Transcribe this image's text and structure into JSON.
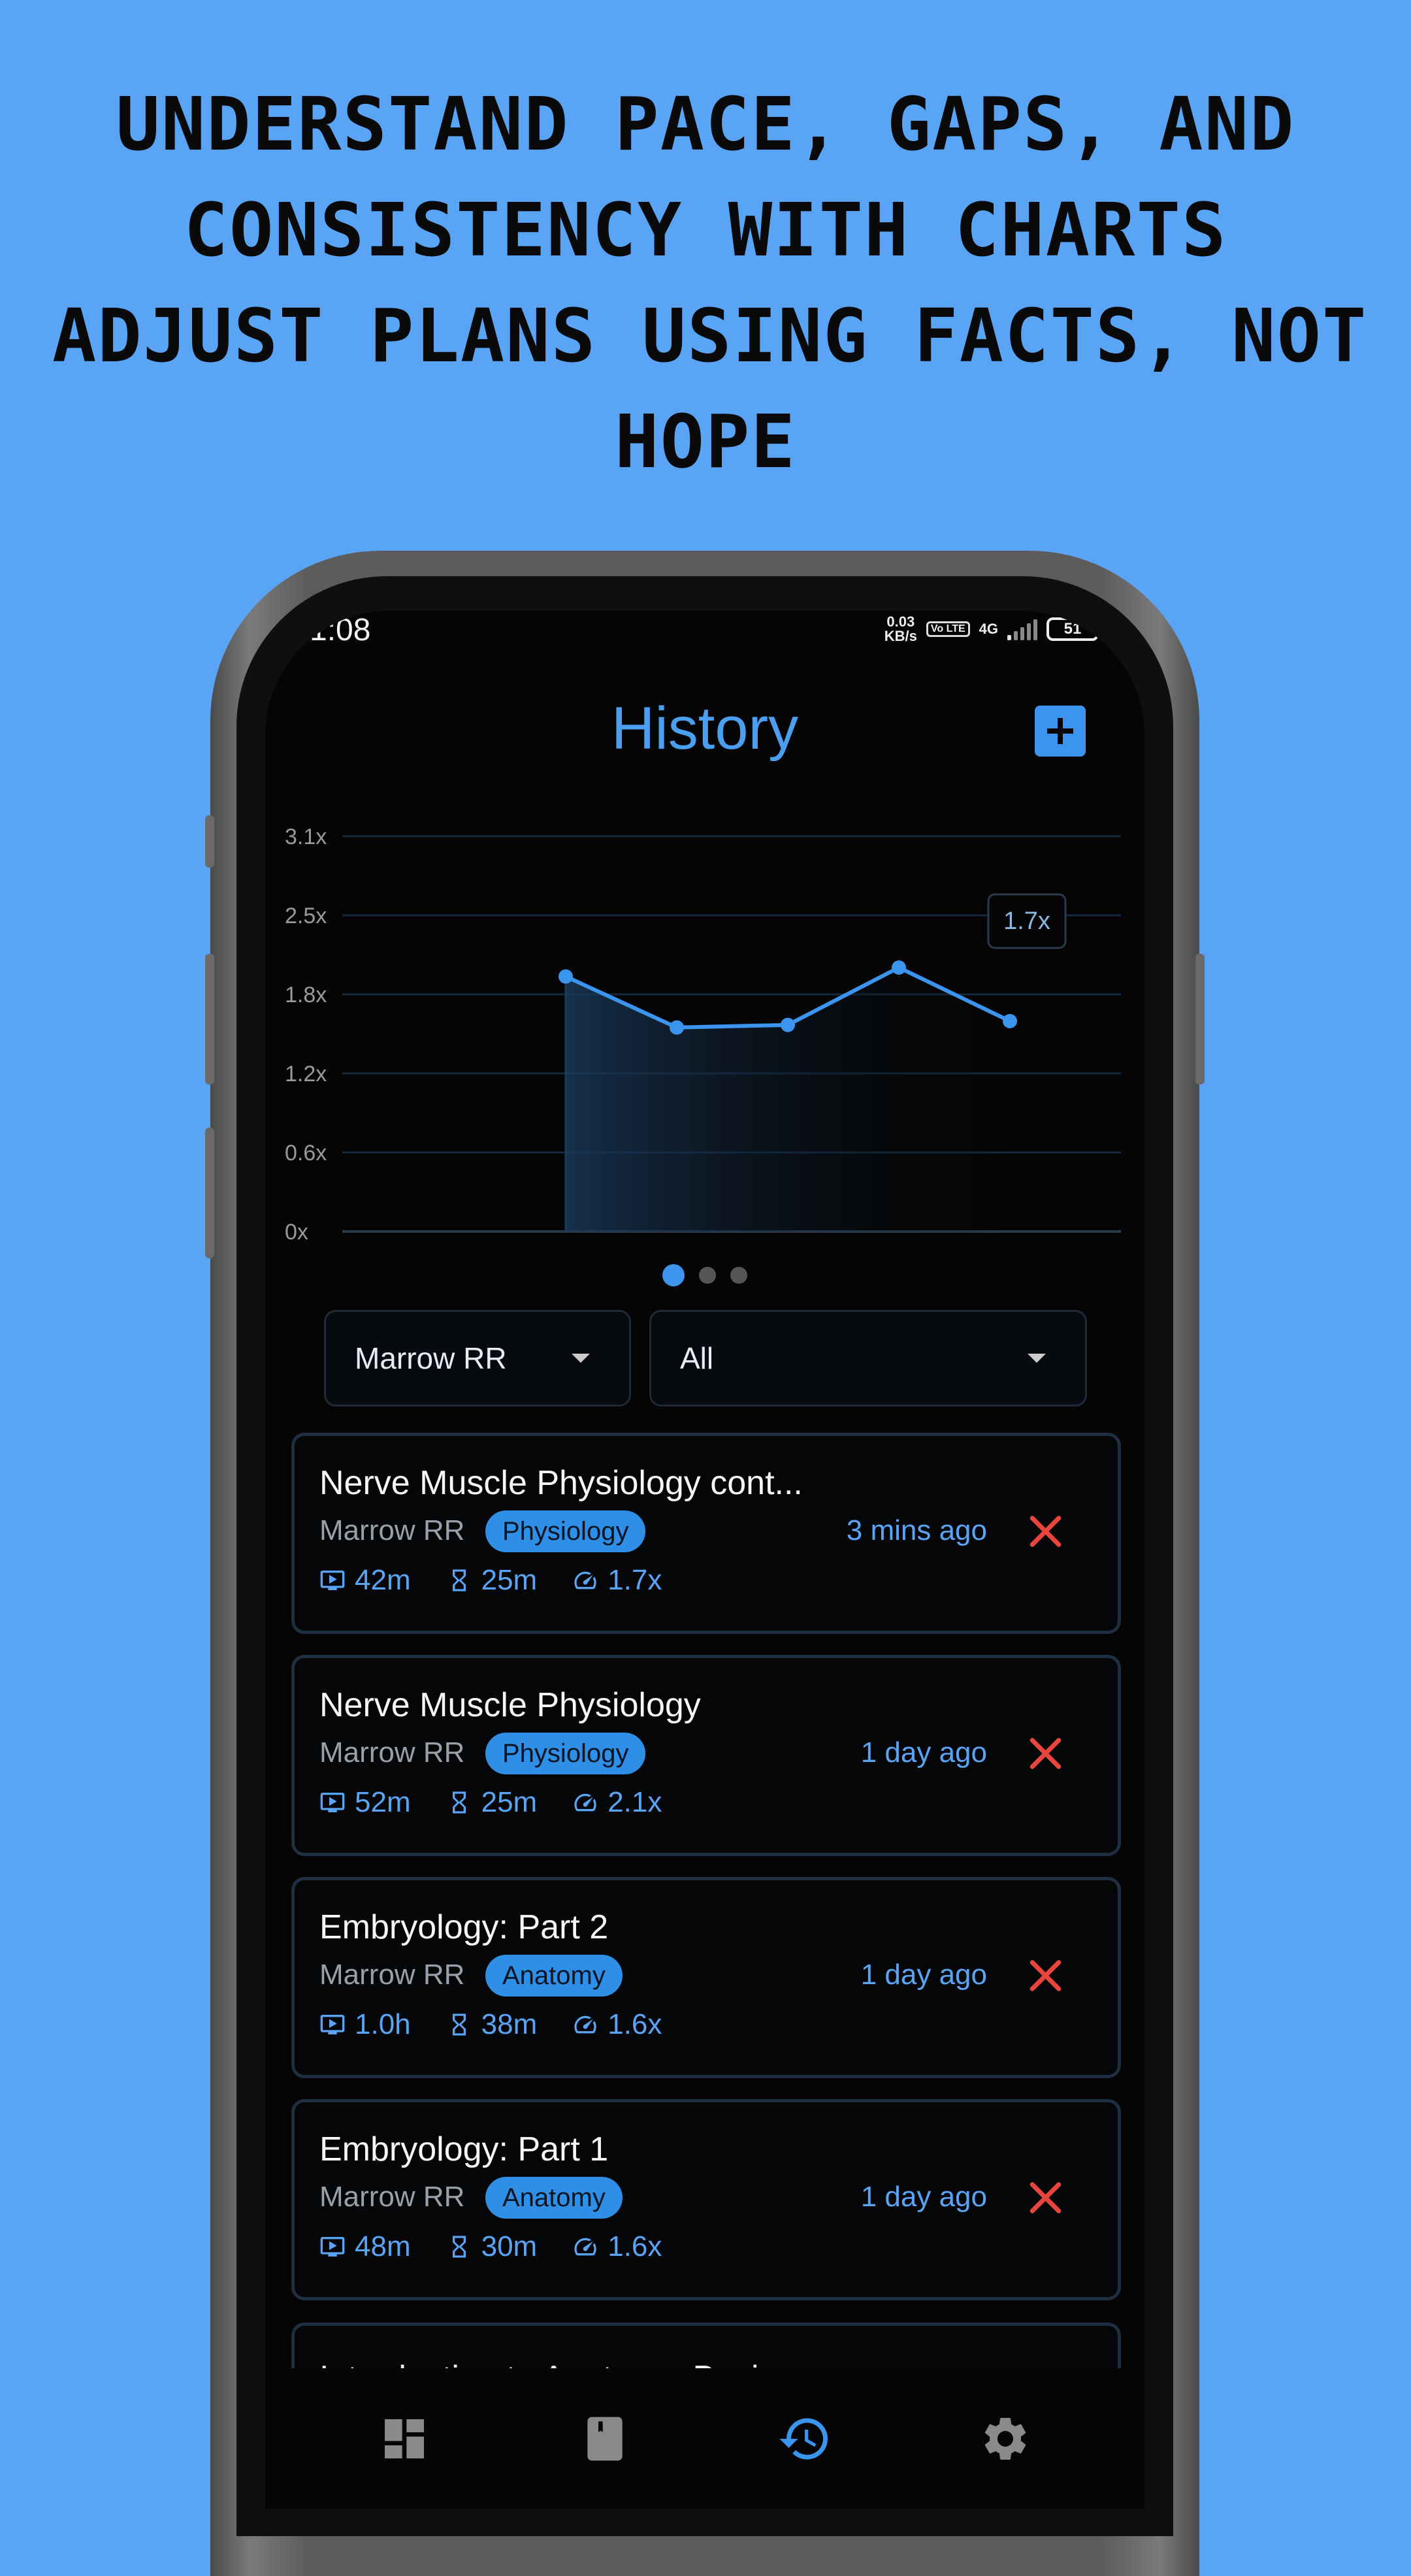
{
  "headline": {
    "line1": "UNDERSTAND PACE, GAPS, AND",
    "line2": "CONSISTENCY WITH CHARTS",
    "line3": "ADJUST PLANS USING FACTS, NOT",
    "line4": "HOPE"
  },
  "status_bar": {
    "time": "1:08",
    "speed_value": "0.03",
    "speed_unit": "KB/s",
    "volte": "Vo LTE",
    "network": "4G",
    "battery": "51"
  },
  "header": {
    "title": "History",
    "add_icon": "plus-icon"
  },
  "chart_data": {
    "type": "line",
    "y_tick_labels": [
      "3.1x",
      "2.5x",
      "1.8x",
      "1.2x",
      "0.6x",
      "0x"
    ],
    "ylim": [
      0,
      3.1
    ],
    "values": [
      2.0,
      1.6,
      1.62,
      2.07,
      1.65
    ],
    "tooltip": "1.7x",
    "line_color": "#3b95ee",
    "grid": true
  },
  "pager": {
    "count": 3,
    "active_index": 0
  },
  "filters": {
    "course": {
      "value": "Marrow RR"
    },
    "subject": {
      "value": "All"
    }
  },
  "sessions": [
    {
      "title": "Nerve Muscle Physiology cont...",
      "course": "Marrow RR",
      "subject": "Physiology",
      "time_ago": "3 mins ago",
      "video": "42m",
      "spent": "25m",
      "speed": "1.7x"
    },
    {
      "title": "Nerve Muscle Physiology",
      "course": "Marrow RR",
      "subject": "Physiology",
      "time_ago": "1 day ago",
      "video": "52m",
      "spent": "25m",
      "speed": "2.1x"
    },
    {
      "title": "Embryology: Part 2",
      "course": "Marrow RR",
      "subject": "Anatomy",
      "time_ago": "1 day ago",
      "video": "1.0h",
      "spent": "38m",
      "speed": "1.6x"
    },
    {
      "title": "Embryology: Part 1",
      "course": "Marrow RR",
      "subject": "Anatomy",
      "time_ago": "1 day ago",
      "video": "48m",
      "spent": "30m",
      "speed": "1.6x"
    }
  ],
  "partial_session": {
    "title": "Introduction to Anatomy, Basic..."
  },
  "bottom_nav": [
    {
      "icon": "dashboard-icon",
      "active": false
    },
    {
      "icon": "book-icon",
      "active": false
    },
    {
      "icon": "history-icon",
      "active": true
    },
    {
      "icon": "settings-icon",
      "active": false
    }
  ],
  "colors": {
    "background": "#5aa4f5",
    "accent": "#3b95ee",
    "danger": "#e8463c"
  }
}
